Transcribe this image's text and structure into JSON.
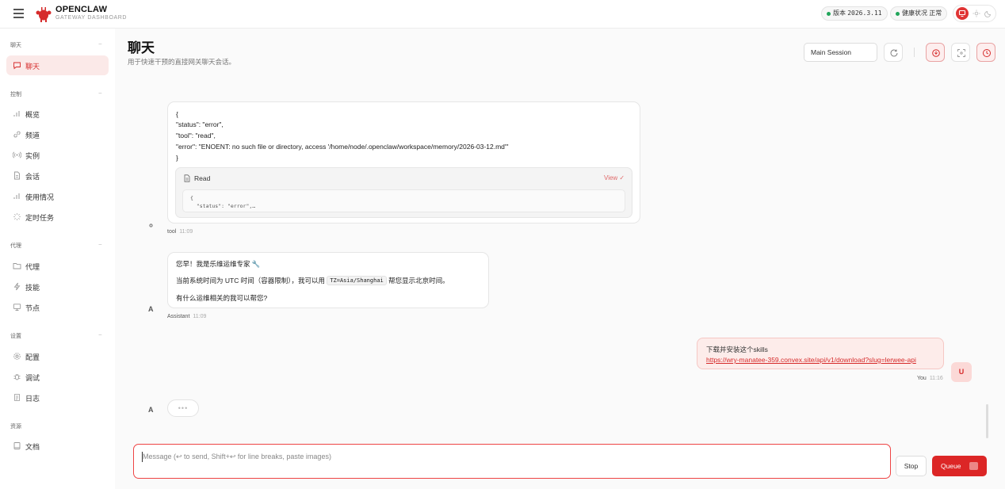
{
  "brand": {
    "name": "OPENCLAW",
    "subtitle": "GATEWAY DASHBOARD"
  },
  "header_status": {
    "version_label": "版本",
    "version_value": "2026.3.11",
    "health_label": "健康状况",
    "health_value": "正常"
  },
  "sidebar": {
    "sections": [
      {
        "title": "聊天",
        "items": [
          {
            "label": "聊天",
            "icon": "chat-icon",
            "active": true
          }
        ]
      },
      {
        "title": "控制",
        "items": [
          {
            "label": "概览",
            "icon": "bar-chart-icon"
          },
          {
            "label": "频道",
            "icon": "link-icon"
          },
          {
            "label": "实例",
            "icon": "radio-icon"
          },
          {
            "label": "会话",
            "icon": "document-icon"
          },
          {
            "label": "使用情况",
            "icon": "bar-chart-icon"
          },
          {
            "label": "定时任务",
            "icon": "loader-icon"
          }
        ]
      },
      {
        "title": "代理",
        "items": [
          {
            "label": "代理",
            "icon": "folder-icon"
          },
          {
            "label": "技能",
            "icon": "bolt-icon"
          },
          {
            "label": "节点",
            "icon": "monitor-icon"
          }
        ]
      },
      {
        "title": "设置",
        "items": [
          {
            "label": "配置",
            "icon": "gear-icon"
          },
          {
            "label": "调试",
            "icon": "bug-icon"
          },
          {
            "label": "日志",
            "icon": "scroll-icon"
          }
        ]
      },
      {
        "title": "资源",
        "items": [
          {
            "label": "文档",
            "icon": "book-icon"
          }
        ]
      }
    ]
  },
  "page": {
    "title": "聊天",
    "subtitle": "用于快速干预的直接网关聊天会话。",
    "session_select": "Main Session"
  },
  "chat": {
    "tool_message": {
      "lines": [
        "{",
        "\"status\": \"error\",",
        "\"tool\": \"read\",",
        "\"error\": \"ENOENT: no such file or directory, access '/home/node/.openclaw/workspace/memory/2026-03-12.md'\"",
        "}"
      ],
      "card_title": "Read",
      "card_view": "View ✓",
      "card_preview": "{\n  \"status\": \"error\",…",
      "sender": "tool",
      "time": "11:09"
    },
    "assistant_message": {
      "line1": "您早！我是乐维运维专家 🔧",
      "line2_before": "当前系统时间为 UTC 时间（容器限制），我可以用",
      "line2_code": "TZ=Asia/Shanghai",
      "line2_after": "帮您显示北京时间。",
      "line3": "有什么运维相关的我可以帮您?",
      "sender": "Assistant",
      "time": "11:09",
      "avatar": "A"
    },
    "user_message": {
      "line1": "下载并安装这个skills",
      "link": "https://wry-manatee-359.convex.site/api/v1/download?slug=lerwee-api",
      "sender": "You",
      "time": "11:16",
      "avatar": "U"
    },
    "typing_avatar": "A",
    "typing_dots": "•••"
  },
  "composer": {
    "placeholder": "Message (↩ to send, Shift+↩ for line breaks, paste images)",
    "stop_label": "Stop",
    "queue_label": "Queue"
  },
  "colors": {
    "accent": "#dc2626",
    "accent_soft": "#fbe9e8",
    "status_ok": "#22a55b"
  }
}
